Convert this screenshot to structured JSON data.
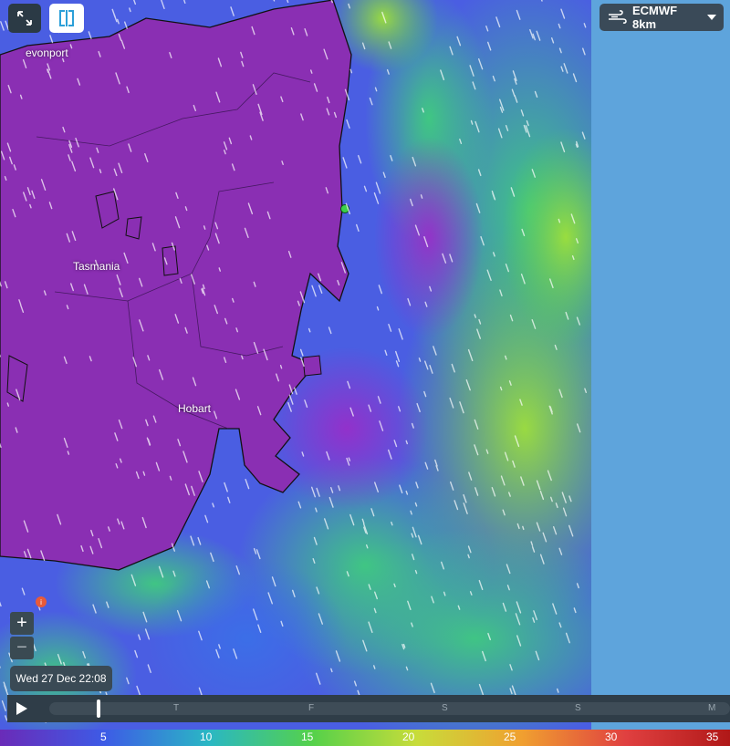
{
  "model_selector": {
    "label": "ECMWF 8km",
    "icon": "wind-icon"
  },
  "map_labels": {
    "devonport": "evonport",
    "tasmania": "Tasmania",
    "hobart": "Hobart"
  },
  "zoom": {
    "in_label": "+",
    "out_label": "−"
  },
  "info_marker": "i",
  "datetime": "Wed 27 Dec 22:08",
  "timeline": {
    "days": [
      "T",
      "F",
      "S",
      "S",
      "M"
    ],
    "position": 0.07
  },
  "legend": {
    "values": [
      "5",
      "10",
      "15",
      "20",
      "25",
      "30",
      "35"
    ],
    "colors": [
      "#6a2bb8",
      "#3d5be6",
      "#2ab7c4",
      "#55d14a",
      "#c8dc3a",
      "#f0a030",
      "#e04040",
      "#b01818"
    ]
  },
  "colors": {
    "land_purple": "#8a2fb3",
    "sea_blue": "#4a58e0",
    "sea_green": "#4bd07a",
    "sky_blue": "#5ea4dc",
    "station_marker": "#3bd04a"
  }
}
